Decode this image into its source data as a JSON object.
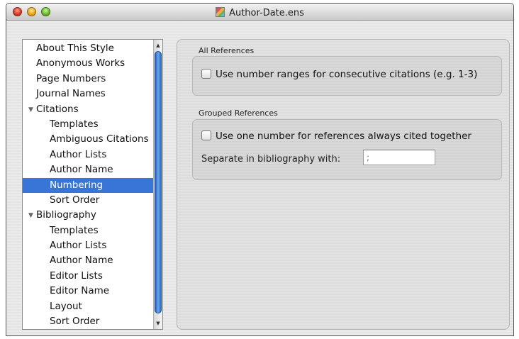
{
  "window": {
    "title": "Author-Date.ens"
  },
  "sidebar": {
    "items": [
      {
        "label": "About This Style",
        "level": 0
      },
      {
        "label": "Anonymous Works",
        "level": 0
      },
      {
        "label": "Page Numbers",
        "level": 0
      },
      {
        "label": "Journal Names",
        "level": 0
      },
      {
        "label": "Citations",
        "level": "group",
        "expanded": true
      },
      {
        "label": "Templates",
        "level": 1
      },
      {
        "label": "Ambiguous Citations",
        "level": 1
      },
      {
        "label": "Author Lists",
        "level": 1
      },
      {
        "label": "Author Name",
        "level": 1
      },
      {
        "label": "Numbering",
        "level": 1,
        "selected": true
      },
      {
        "label": "Sort Order",
        "level": 1
      },
      {
        "label": "Bibliography",
        "level": "group",
        "expanded": true
      },
      {
        "label": "Templates",
        "level": 1
      },
      {
        "label": "Author Lists",
        "level": 1
      },
      {
        "label": "Author Name",
        "level": 1
      },
      {
        "label": "Editor Lists",
        "level": 1
      },
      {
        "label": "Editor Name",
        "level": 1
      },
      {
        "label": "Layout",
        "level": 1
      },
      {
        "label": "Sort Order",
        "level": 1
      }
    ]
  },
  "all_references": {
    "heading": "All References",
    "number_ranges_label": "Use number ranges for consecutive citations (e.g. 1-3)",
    "number_ranges_checked": false
  },
  "grouped_references": {
    "heading": "Grouped References",
    "one_number_label": "Use one number for references always cited together",
    "one_number_checked": false,
    "separator_label": "Separate in bibliography with:",
    "separator_value": ";"
  },
  "colors": {
    "selection": "#3875d7",
    "scroll_thumb": "#3a7be0"
  }
}
